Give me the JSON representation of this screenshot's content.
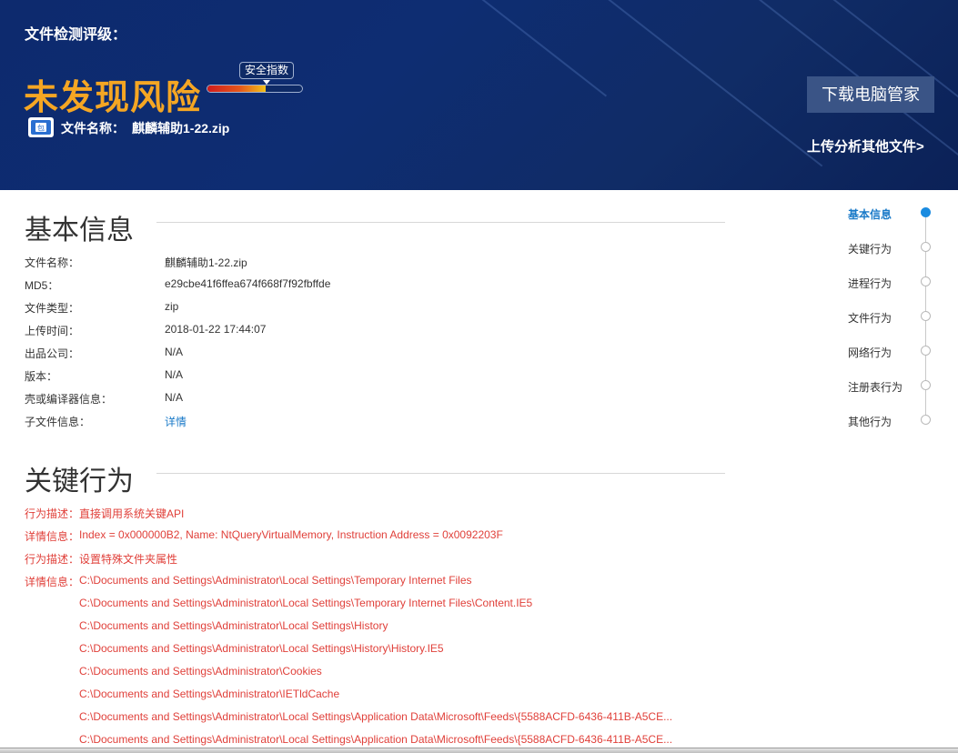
{
  "header": {
    "label": "文件检测评级：",
    "verdict": "未发现风险",
    "safety_tag": "安全指数",
    "safety_level": 0.62,
    "file_label": "文件名称：",
    "file_name": "麒麟辅助1-22.zip",
    "download_button": "下载电脑管家",
    "upload_link": "上传分析其他文件>"
  },
  "basic_info": {
    "title": "基本信息",
    "rows": [
      {
        "label": "文件名称：",
        "value": "麒麟辅助1-22.zip"
      },
      {
        "label": "MD5：",
        "value": "e29cbe41f6ffea674f668f7f92fbffde"
      },
      {
        "label": "文件类型：",
        "value": "zip"
      },
      {
        "label": "上传时间：",
        "value": "2018-01-22 17:44:07"
      },
      {
        "label": "出品公司：",
        "value": "N/A"
      },
      {
        "label": "版本：",
        "value": "N/A"
      },
      {
        "label": "壳或编译器信息：",
        "value": "N/A"
      },
      {
        "label": "子文件信息：",
        "value": "详情"
      }
    ]
  },
  "key_behavior": {
    "title": "关键行为",
    "lines": [
      {
        "prefix": "行为描述：",
        "text": "直接调用系统关键API"
      },
      {
        "prefix": "详情信息：",
        "text": "Index = 0x000000B2, Name: NtQueryVirtualMemory, Instruction Address = 0x0092203F"
      },
      {
        "prefix": "行为描述：",
        "text": "设置特殊文件夹属性"
      },
      {
        "prefix": "详情信息：",
        "text": "C:\\Documents and Settings\\Administrator\\Local Settings\\Temporary Internet Files"
      },
      {
        "prefix": "",
        "text": "C:\\Documents and Settings\\Administrator\\Local Settings\\Temporary Internet Files\\Content.IE5"
      },
      {
        "prefix": "",
        "text": "C:\\Documents and Settings\\Administrator\\Local Settings\\History"
      },
      {
        "prefix": "",
        "text": "C:\\Documents and Settings\\Administrator\\Local Settings\\History\\History.IE5"
      },
      {
        "prefix": "",
        "text": "C:\\Documents and Settings\\Administrator\\Cookies"
      },
      {
        "prefix": "",
        "text": "C:\\Documents and Settings\\Administrator\\IETldCache"
      },
      {
        "prefix": "",
        "text": "C:\\Documents and Settings\\Administrator\\Local Settings\\Application Data\\Microsoft\\Feeds\\{5588ACFD-6436-411B-A5CE..."
      },
      {
        "prefix": "",
        "text": "C:\\Documents and Settings\\Administrator\\Local Settings\\Application Data\\Microsoft\\Feeds\\{5588ACFD-6436-411B-A5CE..."
      }
    ]
  },
  "nav": {
    "items": [
      "基本信息",
      "关键行为",
      "进程行为",
      "文件行为",
      "网络行为",
      "注册表行为",
      "其他行为"
    ],
    "active": "基本信息"
  },
  "colors": {
    "header_bg": "#0e2d72",
    "verdict": "#f5a623",
    "warning_text": "#e0403a",
    "link": "#1a7ac8",
    "button_bg": "#3a5486"
  }
}
